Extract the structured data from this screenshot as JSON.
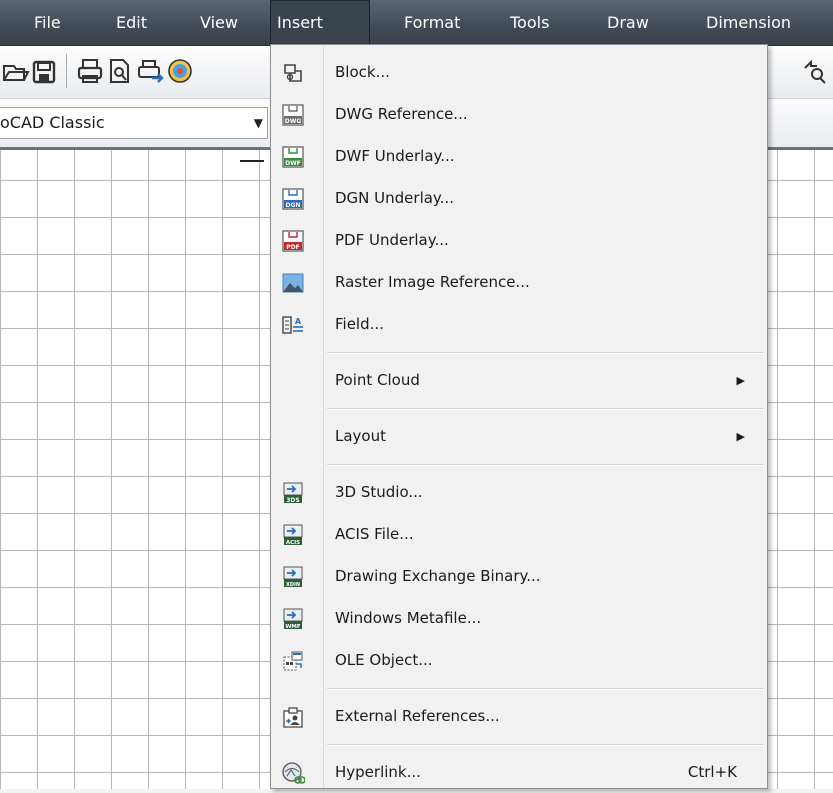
{
  "menubar": {
    "items": [
      "File",
      "Edit",
      "View",
      "Insert",
      "Format",
      "Tools",
      "Draw",
      "Dimension"
    ],
    "active": "Insert"
  },
  "toolbar": {
    "icons": [
      "open-icon",
      "save-icon",
      "print-icon",
      "print-preview-icon",
      "publish-icon",
      "3d-dwf-icon",
      "zoom-previous-icon"
    ]
  },
  "workspace": {
    "selected": "oCAD Classic"
  },
  "menu": {
    "items": [
      {
        "label": "Block...",
        "icon": "block-icon"
      },
      {
        "label": "DWG Reference...",
        "icon": "dwg-reference-icon",
        "tag": "DWG"
      },
      {
        "label": "DWF Underlay...",
        "icon": "dwf-underlay-icon",
        "tag": "DWF"
      },
      {
        "label": "DGN Underlay...",
        "icon": "dgn-underlay-icon",
        "tag": "DGN"
      },
      {
        "label": "PDF Underlay...",
        "icon": "pdf-underlay-icon",
        "tag": "PDF"
      },
      {
        "label": "Raster Image Reference...",
        "icon": "raster-image-icon"
      },
      {
        "label": "Field...",
        "icon": "field-icon"
      },
      {
        "label": "Point Cloud",
        "submenu": true
      },
      {
        "label": "Layout",
        "submenu": true
      },
      {
        "label": "3D Studio...",
        "icon": "3d-studio-icon",
        "tag": "3DS"
      },
      {
        "label": "ACIS File...",
        "icon": "acis-file-icon",
        "tag": "ACIS"
      },
      {
        "label": "Drawing Exchange Binary...",
        "icon": "dxb-icon",
        "tag": "XDIN"
      },
      {
        "label": "Windows Metafile...",
        "icon": "wmf-icon",
        "tag": "WMF"
      },
      {
        "label": "OLE Object...",
        "icon": "ole-object-icon"
      },
      {
        "label": "External References...",
        "icon": "external-references-icon"
      },
      {
        "label": "Hyperlink...",
        "icon": "hyperlink-icon",
        "shortcut": "Ctrl+K"
      }
    ]
  },
  "colors": {
    "menubar_bg": "#4b535d",
    "menu_bg": "#f1f1f1",
    "pdf_red": "#c8262b",
    "icon_blue": "#2a6db5",
    "icon_green": "#3b8a3e"
  }
}
